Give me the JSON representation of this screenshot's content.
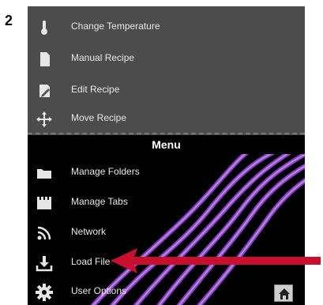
{
  "step_number": "2",
  "top_menu": {
    "items": [
      {
        "label": "Change Temperature",
        "icon": "thermometer-icon"
      },
      {
        "label": "Manual Recipe",
        "icon": "document-icon"
      },
      {
        "label": "Edit Recipe",
        "icon": "edit-icon"
      },
      {
        "label": "Move Recipe",
        "icon": "move-icon"
      }
    ]
  },
  "menu": {
    "header": "Menu",
    "items": [
      {
        "label": "Manage Folders",
        "icon": "folder-icon"
      },
      {
        "label": "Manage Tabs",
        "icon": "tabs-icon"
      },
      {
        "label": "Network",
        "icon": "wifi-icon"
      },
      {
        "label": "Load File",
        "icon": "download-icon"
      },
      {
        "label": "User Options",
        "icon": "gear-icon"
      }
    ]
  },
  "colors": {
    "top_panel": "#4c4c4c",
    "menu_background": "#000000",
    "swirl": "#8a3fc7",
    "arrow": "#c8102e"
  }
}
